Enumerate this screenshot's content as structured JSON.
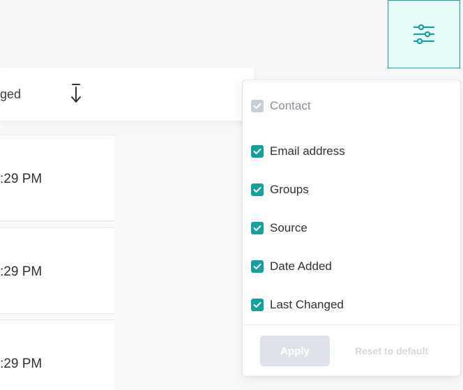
{
  "header": {
    "column_label": "ged",
    "sort_icon": "sort-arrow-icon",
    "settings_icon": "sliders-icon"
  },
  "rows": [
    {
      "time": ":29 PM"
    },
    {
      "time": ":29 PM"
    },
    {
      "time": ":29 PM"
    }
  ],
  "column_settings": {
    "items": [
      {
        "label": "Contact",
        "checked": true,
        "disabled": true
      },
      {
        "label": "Email address",
        "checked": true,
        "disabled": false
      },
      {
        "label": "Groups",
        "checked": true,
        "disabled": false
      },
      {
        "label": "Source",
        "checked": true,
        "disabled": false
      },
      {
        "label": "Date Added",
        "checked": true,
        "disabled": false
      },
      {
        "label": "Last Changed",
        "checked": true,
        "disabled": false
      }
    ],
    "apply_label": "Apply",
    "reset_label": "Reset to default"
  },
  "colors": {
    "accent": "#14a19b",
    "accent_light": "#e6fbf7",
    "disabled": "#c9cdd4"
  }
}
